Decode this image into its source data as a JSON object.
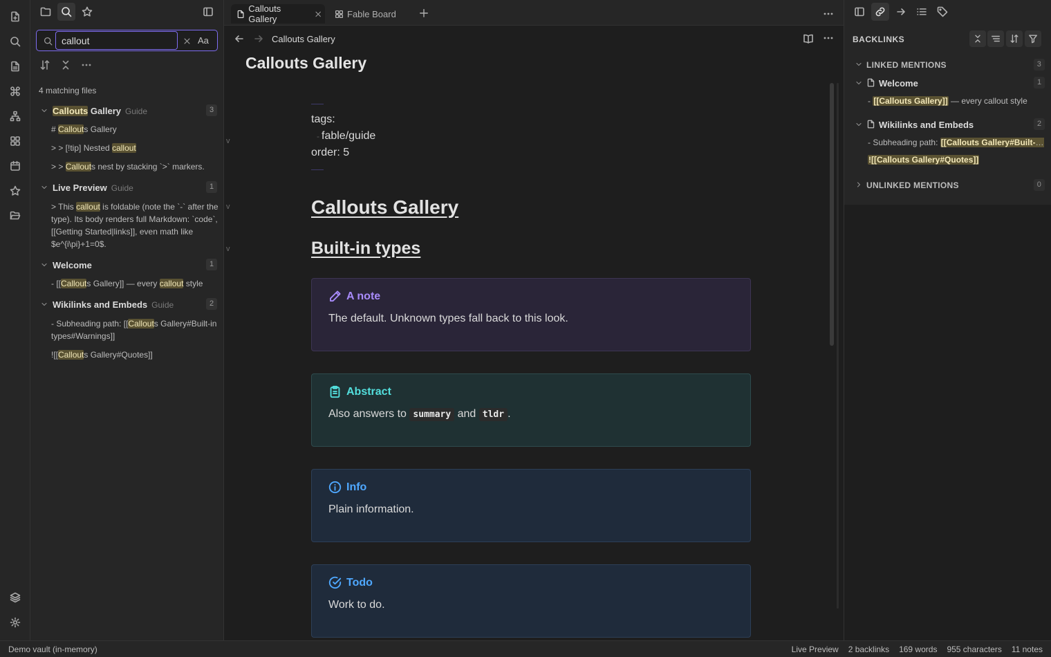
{
  "left_sidebar": {
    "search": {
      "value": "callout",
      "case_label": "Aa"
    },
    "match_count": "4 matching files",
    "results": [
      {
        "title_prefix": "",
        "title_hl": "Callouts",
        "title_rest": " Gallery",
        "tag": "Guide",
        "count": "3",
        "lines": [
          {
            "before": "# ",
            "hl": "Callout",
            "after": "s Gallery"
          },
          {
            "before": "> > [!tip] Nested ",
            "hl": "callout",
            "after": ""
          },
          {
            "before": "> > ",
            "hl": "Callout",
            "after": "s nest by stacking `>` markers."
          }
        ]
      },
      {
        "title": "Live Preview",
        "tag": "Guide",
        "count": "1",
        "lines": [
          {
            "before": "> This ",
            "hl": "callout",
            "after": " is foldable (note the `-` after the type). Its body renders full Markdown: `code`, [[Getting Started|links]], even math like $e^{i\\pi}+1=0$."
          }
        ]
      },
      {
        "title": "Welcome",
        "tag": "",
        "count": "1",
        "lines": [
          {
            "before": "- [[",
            "hl": "Callout",
            "after": "s Gallery]] — every ",
            "hl2": "callout",
            "after2": " style"
          }
        ]
      },
      {
        "title": "Wikilinks and Embeds",
        "tag": "Guide",
        "count": "2",
        "lines": [
          {
            "before": "- Subheading path: [[",
            "hl": "Callout",
            "after": "s Gallery#Built-in types#Warnings]]"
          },
          {
            "before": "![[",
            "hl": "Callout",
            "after": "s Gallery#Quotes]]"
          }
        ]
      }
    ]
  },
  "editor": {
    "tabs": [
      {
        "label": "Callouts Gallery",
        "active": true
      },
      {
        "label": "Fable Board",
        "active": false
      }
    ],
    "view_title": "Callouts Gallery",
    "inline_title": "Callouts Gallery",
    "properties": {
      "tags_label": "tags:",
      "tag_value": "fable/guide",
      "order_line": "order: 5"
    },
    "h1": "Callouts Gallery",
    "h2": "Built-in types",
    "callouts": [
      {
        "title": "A note",
        "icon": "pencil-icon",
        "color": "#a88bfa",
        "bg": "#2a2538",
        "border": "#3d3553",
        "body": "The default. Unknown types fall back to this look."
      },
      {
        "title": "Abstract",
        "icon": "clipboard-icon",
        "color": "#53dfdd",
        "bg": "#1f3133",
        "border": "#2e4b4d",
        "body_before": "Also answers to ",
        "code1": "summary",
        "body_mid": " and ",
        "code2": "tldr",
        "body_after": "."
      },
      {
        "title": "Info",
        "icon": "info-icon",
        "color": "#4fa8ff",
        "bg": "#1f2b3b",
        "border": "#2d3f57",
        "body": "Plain information."
      },
      {
        "title": "Todo",
        "icon": "check-circle-icon",
        "color": "#4fa8ff",
        "bg": "#1f2b3b",
        "border": "#2d3f57",
        "body": "Work to do."
      }
    ]
  },
  "right_sidebar": {
    "title": "BACKLINKS",
    "linked": {
      "label": "LINKED MENTIONS",
      "count": "3"
    },
    "files": [
      {
        "name": "Welcome",
        "count": "1",
        "lines": [
          {
            "before": "- ",
            "hl": "[[Callouts Gallery]]",
            "after": " — every callout style"
          }
        ]
      },
      {
        "name": "Wikilinks and Embeds",
        "count": "2",
        "lines": [
          {
            "before": "- Subheading path: ",
            "hl": "[[Callouts Gallery#Built-in types#Warnings]]",
            "after": ""
          },
          {
            "before": "",
            "hl": "![[Callouts Gallery#Quotes]]",
            "after": ""
          }
        ]
      }
    ],
    "unlinked": {
      "label": "UNLINKED MENTIONS",
      "count": "0"
    }
  },
  "status_bar": {
    "vault": "Demo vault (in-memory)",
    "mode": "Live Preview",
    "backlinks": "2 backlinks",
    "words": "169 words",
    "chars": "955 characters",
    "notes": "11 notes"
  }
}
